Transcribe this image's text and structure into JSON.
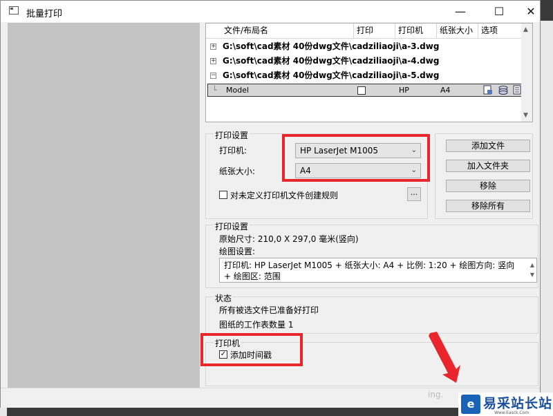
{
  "window": {
    "title": "批量打印",
    "minimize": "—",
    "maximize": "☐",
    "close": "✕"
  },
  "list": {
    "headers": [
      "文件/布局名",
      "打印",
      "打印机",
      "纸张大小",
      "选项"
    ],
    "files": [
      {
        "expander": "+",
        "name": "G:\\soft\\cad素材 40份dwg文件\\cadziliaoji\\a-3.dwg"
      },
      {
        "expander": "+",
        "name": "G:\\soft\\cad素材 40份dwg文件\\cadziliaoji\\a-4.dwg"
      },
      {
        "expander": "−",
        "name": "G:\\soft\\cad素材 40份dwg文件\\cadziliaoji\\a-5.dwg"
      }
    ],
    "layout_row": {
      "name": "Model",
      "print_checked": false,
      "printer": "HP",
      "paper": "A4"
    }
  },
  "print_settings": {
    "title": "打印设置",
    "printer_label": "打印机:",
    "printer_value": "HP LaserJet M1005",
    "paper_label": "纸张大小:",
    "paper_value": "A4",
    "rule_checkbox_label": "对未定义打印机文件创建规则",
    "rule_checked": false,
    "browse_label": "..."
  },
  "buttons": {
    "add_file": "添加文件",
    "add_folder": "加入文件夹",
    "remove": "移除",
    "remove_all": "移除所有"
  },
  "print_info": {
    "title": "打印设置",
    "original_size": "原始尺寸: 210,0 X 297,0 毫米(竖向)",
    "plot_settings_label": "绘图设置:",
    "plot_settings_value": "打印机: HP LaserJet M1005 + 纸张大小: A4 + 比例: 1:20 + 绘图方向: 竖向 + 绘图区: 范围"
  },
  "status": {
    "title": "状态",
    "line1": "所有被选文件已准备好打印",
    "line2": "图纸的工作表数量 1"
  },
  "printer_options": {
    "title": "打印机",
    "timestamp_label": "添加时间戳",
    "timestamp_checked": true
  },
  "watermark": {
    "logo": "e",
    "text": "易采站长站",
    "sub": "Www.Easck.Com"
  },
  "colors": {
    "highlight_red": "#e8262c",
    "left_pane": "#c4c4c4"
  }
}
